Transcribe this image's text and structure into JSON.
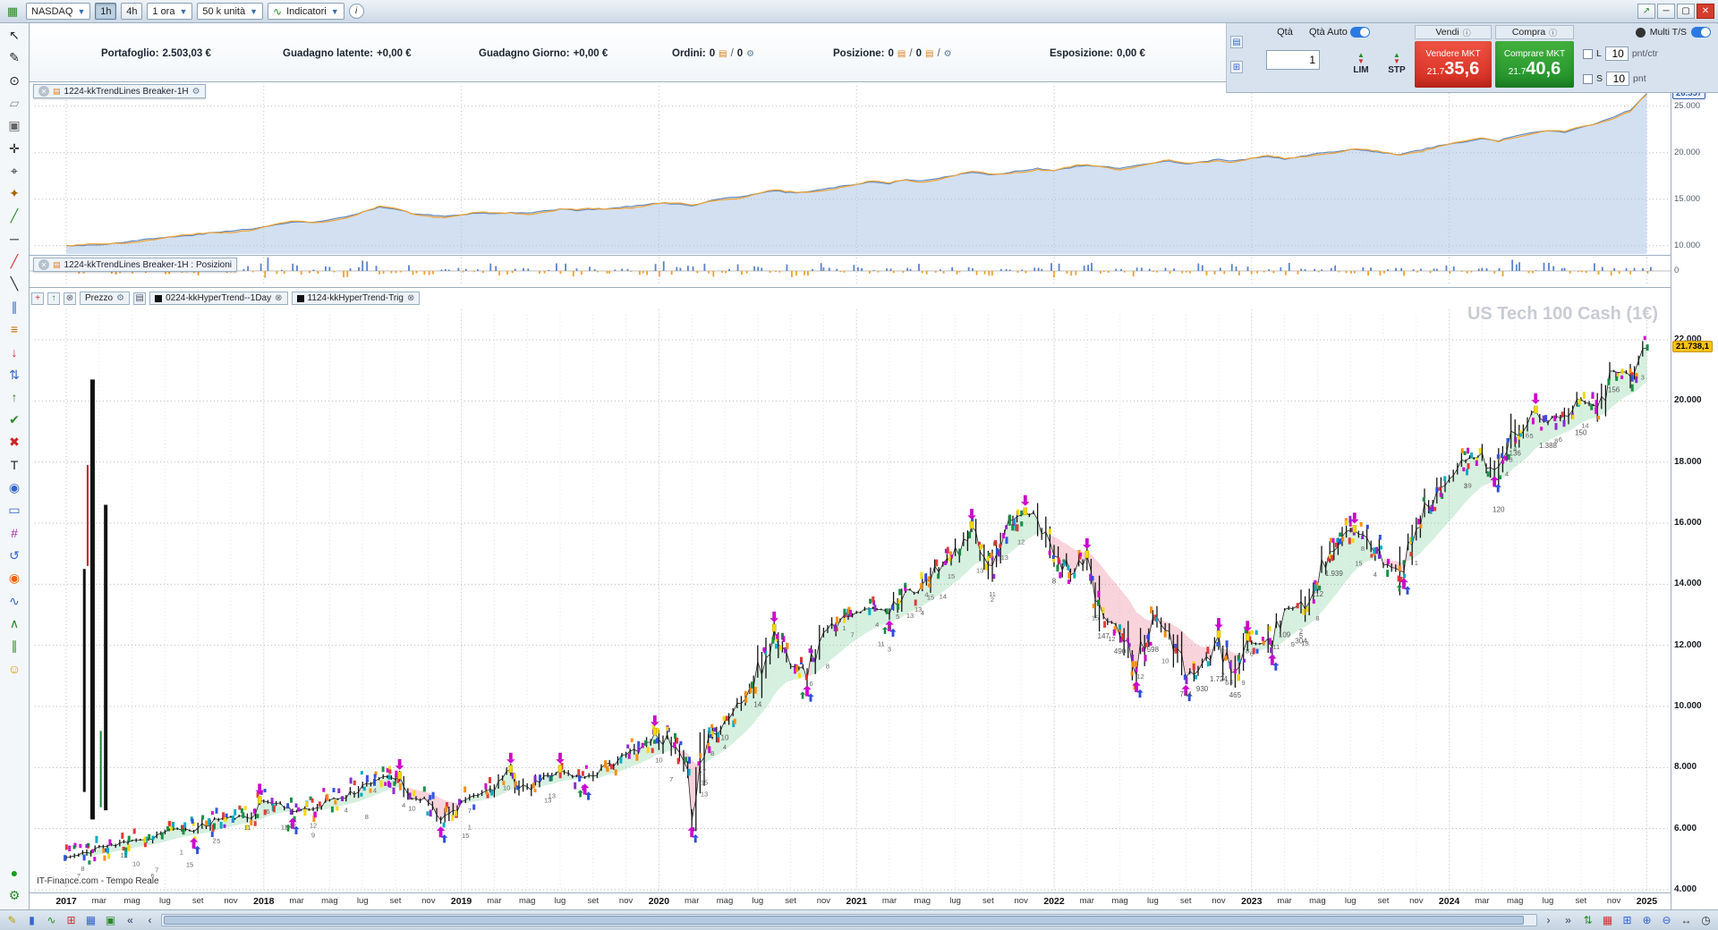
{
  "titlebar": {
    "instrument": "NASDAQ",
    "tf_1h": "1h",
    "tf_4h": "4h",
    "timeframe": "1 ora",
    "units": "50 k unità",
    "indicators": "Indicatori",
    "info": "i"
  },
  "account": {
    "items": [
      {
        "label": "Portafoglio:",
        "value": "2.503,03 €"
      },
      {
        "label": "Guadagno latente:",
        "value": "+0,00 €"
      },
      {
        "label": "Guadagno Giorno:",
        "value": "+0,00 €"
      },
      {
        "label": "Ordini:",
        "value": "0",
        "value2": "0"
      },
      {
        "label": "Posizione:",
        "value": "0",
        "value2": "0"
      },
      {
        "label": "Esposizione:",
        "value": "0,00 €"
      }
    ]
  },
  "trade_panel": {
    "qty_label": "Qtà",
    "qty_auto_label": "Qtà Auto",
    "qty_value": "1",
    "lim": "LIM",
    "stp": "STP",
    "sell_header": "Vendi",
    "buy_header": "Compra",
    "sell_button": "Vendere MKT",
    "buy_button": "Comprare MKT",
    "sell_price_small": "21.7",
    "sell_price_big": "35,6",
    "buy_price_small": "21.7",
    "buy_price_big": "40,6",
    "limit_label": "L",
    "limit_value": "10",
    "limit_unit": "pnt/ctr",
    "stop_label": "S",
    "stop_value": "10",
    "stop_unit": "pnt",
    "multi_ts": "Multi T/S"
  },
  "panels": {
    "equity_title": "1224-kkTrendLines Breaker-1H",
    "positions_title": "1224-kkTrendLines Breaker-1H : Posizioni",
    "price_title": "Prezzo",
    "ind1": "0224-kkHyperTrend--1Day",
    "ind2": "1124-kkHyperTrend-Trig",
    "watermark": "US Tech 100 Cash (1€)",
    "status": "IT-Finance.com - Tempo Reale"
  },
  "left_toolbar": {
    "icons": [
      {
        "name": "cursor-tool-icon",
        "glyph": "↖",
        "color": "#222222"
      },
      {
        "name": "pencil-tool-icon",
        "glyph": "✎",
        "color": "#222222"
      },
      {
        "name": "zoom-tool-icon",
        "glyph": "⊙",
        "color": "#222222"
      },
      {
        "name": "eraser-tool-icon",
        "glyph": "▱",
        "color": "#888888"
      },
      {
        "name": "delete-tool-icon",
        "glyph": "▣",
        "color": "#666666"
      },
      {
        "name": "move-tool-icon",
        "glyph": "✛",
        "color": "#222222"
      },
      {
        "name": "crosshair-tool-icon",
        "glyph": "⌖",
        "color": "#222222"
      },
      {
        "name": "magnet-tool-icon",
        "glyph": "✦",
        "color": "#aa6600"
      },
      {
        "name": "trendline-tool-icon",
        "glyph": "╱",
        "color": "#2a8a2a"
      },
      {
        "name": "horizontal-line-tool-icon",
        "glyph": "─",
        "color": "#222222"
      },
      {
        "name": "ray-tool-icon",
        "glyph": "╱",
        "color": "#cc3333"
      },
      {
        "name": "segment-tool-icon",
        "glyph": "╲",
        "color": "#222222"
      },
      {
        "name": "parallel-lines-tool-icon",
        "glyph": "∥",
        "color": "#3366cc"
      },
      {
        "name": "fibonacci-tool-icon",
        "glyph": "≡",
        "color": "#cc6600"
      },
      {
        "name": "sell-arrow-icon",
        "glyph": "↓",
        "color": "#cc2222"
      },
      {
        "name": "updown-arrows-icon",
        "glyph": "⇅",
        "color": "#3366cc"
      },
      {
        "name": "buy-arrow-icon",
        "glyph": "↑",
        "color": "#2a8a2a"
      },
      {
        "name": "confirm-icon",
        "glyph": "✔",
        "color": "#2a8a2a"
      },
      {
        "name": "cancel-icon",
        "glyph": "✖",
        "color": "#cc2222"
      },
      {
        "name": "text-tool-icon",
        "glyph": "T",
        "color": "#222222"
      },
      {
        "name": "pin-tool-icon",
        "glyph": "◉",
        "color": "#3366cc"
      },
      {
        "name": "rectangle-tool-icon",
        "glyph": "▭",
        "color": "#3366cc"
      },
      {
        "name": "pattern-tool-icon",
        "glyph": "#",
        "color": "#aa33aa"
      },
      {
        "name": "rotate-tool-icon",
        "glyph": "↺",
        "color": "#3366cc"
      },
      {
        "name": "alert-tool-icon",
        "glyph": "◉",
        "color": "#ee6600"
      },
      {
        "name": "stats-tool-icon",
        "glyph": "∿",
        "color": "#3366cc"
      },
      {
        "name": "zigzag-tool-icon",
        "glyph": "∧",
        "color": "#2a8a2a"
      },
      {
        "name": "channel-tool-icon",
        "glyph": "∥",
        "color": "#2a8a2a"
      },
      {
        "name": "emoji-tool-icon",
        "glyph": "☺",
        "color": "#cc9900"
      }
    ],
    "extra_icons": [
      {
        "name": "connection-status-icon",
        "glyph": "●",
        "color": "#18a018"
      },
      {
        "name": "toolbar-settings-icon",
        "glyph": "⚙",
        "color": "#2a8a2a"
      }
    ]
  },
  "bottom_toolbar": {
    "left_icons": [
      {
        "name": "draw-mode-icon",
        "glyph": "✎",
        "color": "#b8a000"
      },
      {
        "name": "candlestick-view-icon",
        "glyph": "▮",
        "color": "#3366cc"
      },
      {
        "name": "line-chart-view-icon",
        "glyph": "∿",
        "color": "#2a8a2a"
      },
      {
        "name": "grid-view-icon",
        "glyph": "⊞",
        "color": "#cc3333"
      },
      {
        "name": "layout-icon",
        "glyph": "▦",
        "color": "#3366cc"
      },
      {
        "name": "snapshot-icon",
        "glyph": "▣",
        "color": "#2a8a2a"
      }
    ],
    "scroll_far_left": "«",
    "scroll_left": "‹",
    "scroll_right": "›",
    "scroll_far_right": "»",
    "right_icons": [
      {
        "name": "auto-scroll-icon",
        "glyph": "⇅",
        "color": "#2a8a2a"
      },
      {
        "name": "calendar-icon",
        "glyph": "▦",
        "color": "#cc3333"
      },
      {
        "name": "windows-icon",
        "glyph": "⊞",
        "color": "#3366cc"
      },
      {
        "name": "zoom-in-icon",
        "glyph": "⊕",
        "color": "#3366cc"
      },
      {
        "name": "zoom-out-icon",
        "glyph": "⊖",
        "color": "#3366cc"
      },
      {
        "name": "fit-width-icon",
        "glyph": "↔",
        "color": "#333333"
      },
      {
        "name": "clock-icon",
        "glyph": "◷",
        "color": "#333333"
      }
    ]
  },
  "chart_data": [
    {
      "id": "equity",
      "type": "area",
      "title": "1224-kkTrendLines Breaker-1H",
      "ylim": [
        9500,
        27000
      ],
      "yticks": [
        {
          "v": 26357,
          "label": "26.357",
          "badge": true
        },
        {
          "v": 25000,
          "label": "25.000"
        },
        {
          "v": 20000,
          "label": "20.000"
        },
        {
          "v": 15000,
          "label": "15.000"
        },
        {
          "v": 10000,
          "label": "10.000"
        }
      ],
      "monthly": [
        10000,
        10050,
        10100,
        10300,
        10500,
        10700,
        10900,
        11000,
        11200,
        11400,
        11600,
        11800,
        12000,
        12300,
        12600,
        12500,
        12800,
        13100,
        13600,
        14100,
        13900,
        13500,
        13300,
        13200,
        13300,
        13500,
        13400,
        13600,
        13500,
        13700,
        13900,
        13800,
        13900,
        14000,
        14200,
        14400,
        14600,
        14500,
        14300,
        14800,
        15100,
        15300,
        15600,
        15900,
        15700,
        15800,
        16100,
        16400,
        16600,
        16900,
        16700,
        17100,
        17000,
        17300,
        17600,
        17900,
        17600,
        17800,
        18100,
        18300,
        18100,
        18400,
        18700,
        18500,
        18300,
        18600,
        18900,
        19100,
        18800,
        19000,
        19300,
        19100,
        19400,
        19600,
        19300,
        19600,
        19900,
        20100,
        20400,
        20200,
        20000,
        19800,
        20200,
        20600,
        20900,
        21200,
        21500,
        21300,
        21800,
        22100,
        22400,
        22200,
        22700,
        23200,
        23900,
        24600,
        26357
      ]
    },
    {
      "id": "positions",
      "type": "bar",
      "title": "1224-kkTrendLines Breaker-1H : Posizioni",
      "ylim": [
        -6,
        8
      ],
      "ytick": "0",
      "values": [
        2,
        -1,
        1,
        -2,
        3,
        -1,
        2,
        1,
        -2,
        4,
        -1,
        2,
        5,
        -2,
        3,
        -1,
        2,
        -3,
        4,
        2,
        -1,
        3,
        -2,
        1,
        2,
        -1,
        4,
        -2,
        1,
        -1,
        3,
        -2,
        2,
        -1,
        1,
        -2,
        6,
        -3,
        2,
        4,
        -2,
        3,
        2,
        -1,
        5,
        -2,
        3,
        1,
        3,
        -1,
        2,
        -2,
        4,
        -1,
        2,
        3,
        -2,
        1,
        -1,
        2,
        4,
        -2,
        3,
        -1,
        2,
        -3,
        1,
        2,
        -1,
        3,
        -2,
        4,
        2,
        -1,
        3,
        -2,
        1,
        2,
        -1,
        4,
        -2,
        3,
        1,
        -2,
        3,
        -1,
        2,
        -2,
        5,
        -1,
        3,
        2,
        -1,
        4,
        -2,
        3,
        2
      ]
    },
    {
      "id": "price",
      "type": "candlestick",
      "instrument": "US Tech 100 Cash (1€)",
      "ylim": [
        4000,
        22000
      ],
      "grid_step": 2000,
      "yticks": [
        {
          "v": 22000,
          "label": "22.000"
        },
        {
          "v": 20000,
          "label": "20.000"
        },
        {
          "v": 18000,
          "label": "18.000"
        },
        {
          "v": 16000,
          "label": "16.000"
        },
        {
          "v": 14000,
          "label": "14.000"
        },
        {
          "v": 12000,
          "label": "12.000"
        },
        {
          "v": 10000,
          "label": "10.000"
        },
        {
          "v": 8000,
          "label": "8.000"
        },
        {
          "v": 6000,
          "label": "6.000"
        },
        {
          "v": 4000,
          "label": "4.000"
        }
      ],
      "last_price": {
        "value": 21738.1,
        "label": "21.738,1"
      },
      "years": [
        "2017",
        "2018",
        "2019",
        "2020",
        "2021",
        "2022",
        "2023",
        "2024",
        "2025"
      ],
      "month_ticks": [
        {
          "m": 2,
          "l": "mar"
        },
        {
          "m": 4,
          "l": "mag"
        },
        {
          "m": 6,
          "l": "lug"
        },
        {
          "m": 8,
          "l": "set"
        },
        {
          "m": 10,
          "l": "nov"
        }
      ],
      "monthly": [
        5050,
        5150,
        5400,
        5450,
        5650,
        5650,
        5900,
        5990,
        5950,
        6300,
        6350,
        6400,
        6900,
        6800,
        6580,
        6650,
        6940,
        7040,
        7400,
        7650,
        7660,
        7000,
        6950,
        6330,
        6870,
        7060,
        7380,
        7820,
        7200,
        7670,
        7900,
        7700,
        7750,
        8080,
        8400,
        8730,
        9150,
        8460,
        7000,
        9000,
        9550,
        10150,
        10900,
        12400,
        11400,
        11200,
        12250,
        12890,
        13100,
        13200,
        13090,
        13850,
        13690,
        14550,
        14960,
        15600,
        14690,
        15850,
        16300,
        16320,
        15200,
        14260,
        14840,
        12870,
        12640,
        11500,
        12950,
        12270,
        10970,
        11400,
        11990,
        10940,
        12100,
        12040,
        13180,
        13240,
        14250,
        15180,
        15750,
        15500,
        14720,
        14400,
        15950,
        16830,
        17600,
        18040,
        18250,
        17540,
        18860,
        19680,
        19360,
        19570,
        20060,
        19890,
        20930,
        21010,
        21738
      ],
      "palette": [
        "#cc00cc",
        "#2b4bdd",
        "#0f8a3c",
        "#f5d800",
        "#ff8a00",
        "#8822cc",
        "#00a6c0",
        "#e03030"
      ],
      "anomalies": [
        {
          "mi": 1.6,
          "top": 20700,
          "bottom": 6300,
          "w": 5,
          "color": "#111111"
        },
        {
          "mi": 2.4,
          "top": 16600,
          "bottom": 6600,
          "w": 4,
          "color": "#111111"
        },
        {
          "mi": 1.1,
          "top": 14500,
          "bottom": 7200,
          "w": 3,
          "color": "#111111"
        },
        {
          "mi": 1.3,
          "top": 17900,
          "bottom": 14600,
          "w": 2,
          "color": "#cc2222"
        },
        {
          "mi": 2.1,
          "top": 9200,
          "bottom": 6700,
          "w": 2,
          "color": "#118833"
        }
      ],
      "annotations": [
        {
          "mi": 40,
          "t": "10"
        },
        {
          "mi": 42,
          "t": "14"
        },
        {
          "mi": 60,
          "t": "8"
        },
        {
          "mi": 63,
          "t": "147"
        },
        {
          "mi": 64,
          "t": "490"
        },
        {
          "mi": 66,
          "t": "598"
        },
        {
          "mi": 68,
          "t": "744"
        },
        {
          "mi": 69,
          "t": "930"
        },
        {
          "mi": 70,
          "t": "1.724"
        },
        {
          "mi": 71,
          "t": "465"
        },
        {
          "mi": 74,
          "t": "109"
        },
        {
          "mi": 75,
          "t": "304"
        },
        {
          "mi": 76,
          "t": "212"
        },
        {
          "mi": 77,
          "t": "1.939"
        },
        {
          "mi": 87,
          "t": "120"
        },
        {
          "mi": 88,
          "t": "136"
        },
        {
          "mi": 90,
          "t": "1.388"
        },
        {
          "mi": 92,
          "t": "150"
        },
        {
          "mi": 94,
          "t": "156"
        }
      ]
    }
  ]
}
